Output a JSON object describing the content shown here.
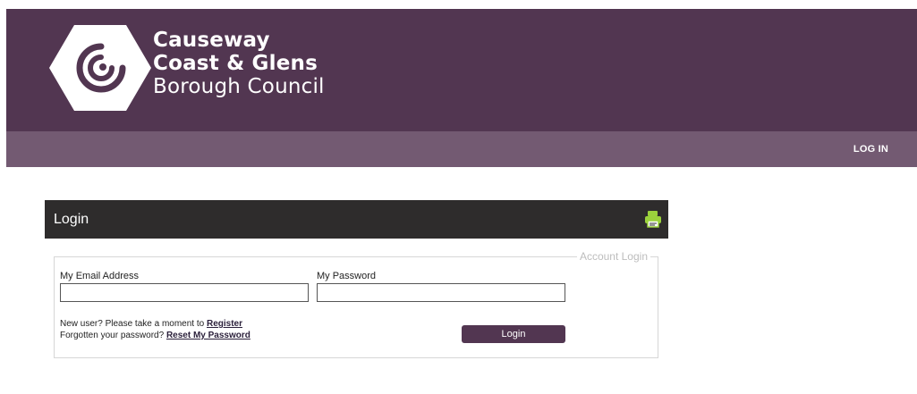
{
  "brand": {
    "line1": "Causeway",
    "line2": "Coast & Glens",
    "line3": "Borough Council",
    "header_color": "#523651",
    "nav_color": "#735a72"
  },
  "nav": {
    "login_link": "LOG IN"
  },
  "panel": {
    "title": "Login",
    "icon": "print-icon"
  },
  "form": {
    "legend": "Account Login",
    "email_label": "My Email Address",
    "email_value": "",
    "password_label": "My Password",
    "password_value": "",
    "register_prompt": "New user? Please take a moment to ",
    "register_link": "Register",
    "reset_prompt": "Forgotten your password? ",
    "reset_link": "Reset My Password",
    "submit_label": "Login"
  }
}
